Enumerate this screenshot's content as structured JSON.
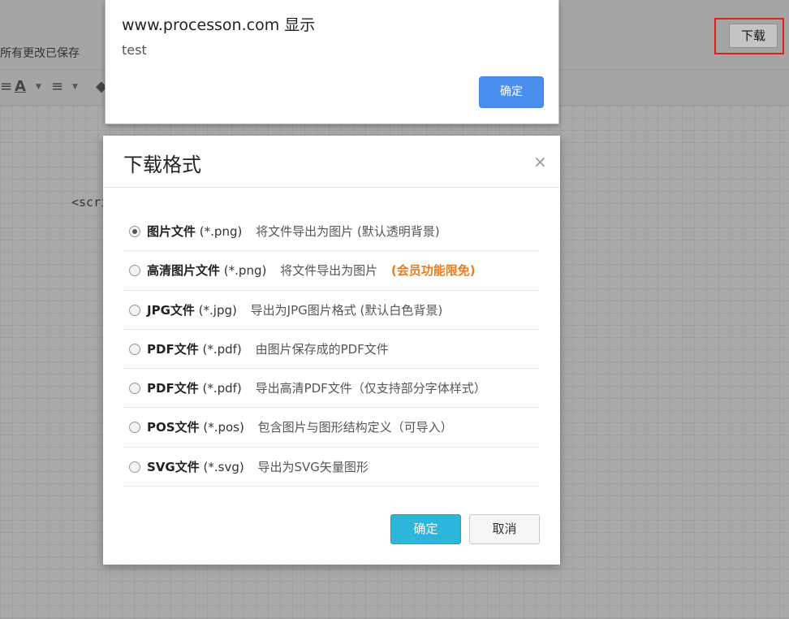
{
  "app": {
    "save_status": "所有更改已保存",
    "download_label": "下载",
    "canvas_text": "<scrip"
  },
  "toolbar": {
    "icons": [
      "align-icon",
      "font-color-icon",
      "text-align-icon",
      "paint-bucket-icon"
    ]
  },
  "alert": {
    "title": "www.processon.com 显示",
    "message": "test",
    "ok_label": "确定"
  },
  "dialog": {
    "title": "下载格式",
    "close_glyph": "×",
    "options": [
      {
        "name": "图片文件",
        "ext": "(*.png)",
        "desc": "将文件导出为图片 (默认透明背景)",
        "vip": "",
        "checked": true
      },
      {
        "name": "高清图片文件",
        "ext": "(*.png)",
        "desc": "将文件导出为图片",
        "vip": "(会员功能限免)",
        "checked": false
      },
      {
        "name": "JPG文件",
        "ext": "(*.jpg)",
        "desc": "导出为JPG图片格式 (默认白色背景)",
        "vip": "",
        "checked": false
      },
      {
        "name": "PDF文件",
        "ext": "(*.pdf)",
        "desc": "由图片保存成的PDF文件",
        "vip": "",
        "checked": false
      },
      {
        "name": "PDF文件",
        "ext": "(*.pdf)",
        "desc": "导出高清PDF文件（仅支持部分字体样式）",
        "vip": "",
        "checked": false
      },
      {
        "name": "POS文件",
        "ext": "(*.pos)",
        "desc": "包含图片与图形结构定义（可导入）",
        "vip": "",
        "checked": false
      },
      {
        "name": "SVG文件",
        "ext": "(*.svg)",
        "desc": "导出为SVG矢量图形",
        "vip": "",
        "checked": false
      }
    ],
    "confirm_label": "确定",
    "cancel_label": "取消"
  },
  "colors": {
    "vip": "#ee7b1b",
    "confirm": "#2db5dc",
    "alert_ok": "#4a8ff0",
    "highlight": "#e0201a"
  }
}
